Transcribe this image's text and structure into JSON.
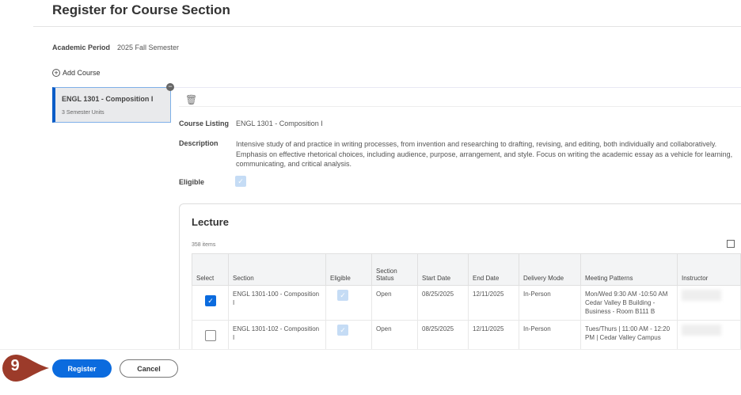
{
  "page_title": "Register for Course Section",
  "academic_period": {
    "label": "Academic Period",
    "value": "2025 Fall Semester"
  },
  "add_course": "Add Course",
  "course_card": {
    "title": "ENGL 1301 - Composition I",
    "units": "3 Semester Units"
  },
  "details": {
    "course_listing_label": "Course Listing",
    "course_listing": "ENGL 1301 - Composition I",
    "description_label": "Description",
    "description": "Intensive study of and practice in writing processes, from invention and researching to drafting, revising, and editing, both individually and collaboratively. Emphasis on effective rhetorical choices, including audience, purpose, arrangement, and style. Focus on writing the academic essay as a vehicle for learning, communicating, and critical analysis.",
    "eligible_label": "Eligible"
  },
  "lecture": {
    "title": "Lecture",
    "count": "358 items",
    "columns": [
      "Select",
      "Section",
      "Eligible",
      "Section Status",
      "Start Date",
      "End Date",
      "Delivery Mode",
      "Meeting Patterns",
      "Instructor"
    ],
    "rows": [
      {
        "selected": true,
        "section": "ENGL 1301-100 - Composition I",
        "status": "Open",
        "start": "08/25/2025",
        "end": "12/11/2025",
        "mode": "In-Person",
        "meeting": "Mon/Wed 9:30 AM -10:50 AM Cedar Valley B Building - Business - Room B111 B"
      },
      {
        "selected": false,
        "section": "ENGL 1301-102 - Composition I",
        "status": "Open",
        "start": "08/25/2025",
        "end": "12/11/2025",
        "mode": "In-Person",
        "meeting": "Tues/Thurs | 11:00 AM - 12:20 PM | Cedar Valley Campus"
      }
    ]
  },
  "buttons": {
    "register": "Register",
    "cancel": "Cancel"
  },
  "step_badge": "9",
  "colors": {
    "primary": "#0b6bde",
    "badge": "#9c3b2a"
  }
}
